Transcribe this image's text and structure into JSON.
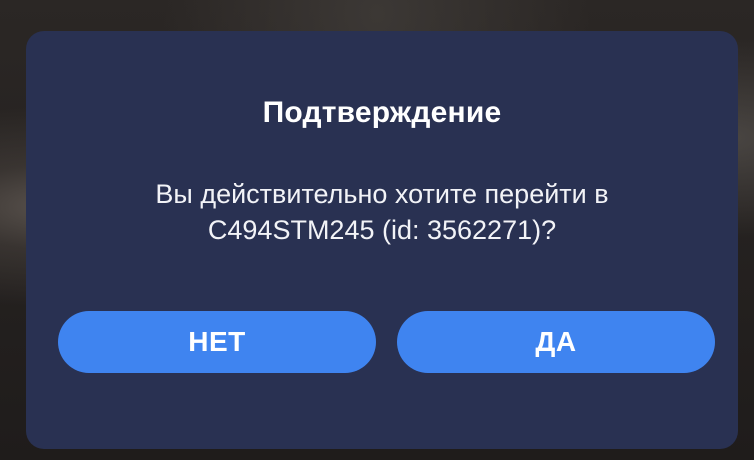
{
  "dialog": {
    "title": "Подтверждение",
    "message_line1": "Вы действительно хотите перейти в",
    "message_line2": "C494STM245 (id: 3562271)?",
    "buttons": {
      "no_label": "НЕТ",
      "yes_label": "ДА"
    }
  },
  "colors": {
    "dialog_background": "#293152",
    "button_background": "#3f84f0",
    "text": "#ffffff"
  }
}
